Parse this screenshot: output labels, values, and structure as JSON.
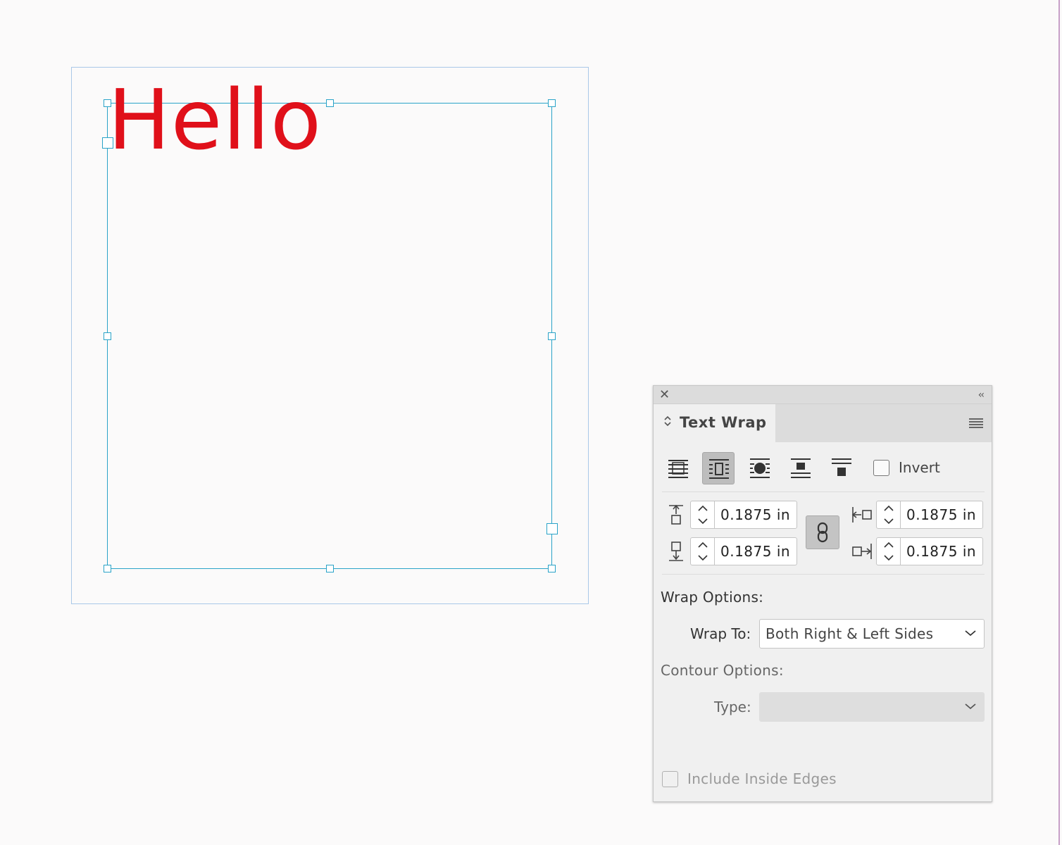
{
  "canvas": {
    "text": "Hello",
    "text_color": "#e0101a",
    "frame_color": "#2aa3c8"
  },
  "panel": {
    "title": "Text Wrap",
    "wrap_modes": [
      {
        "name": "no-text-wrap",
        "active": false
      },
      {
        "name": "wrap-around-bounding-box",
        "active": true
      },
      {
        "name": "wrap-around-object-shape",
        "active": false
      },
      {
        "name": "jump-object",
        "active": false
      },
      {
        "name": "jump-to-next-column",
        "active": false
      }
    ],
    "invert_label": "Invert",
    "offsets": {
      "top": "0.1875 in",
      "bottom": "0.1875 in",
      "left": "0.1875 in",
      "right": "0.1875 in"
    },
    "wrap_options_label": "Wrap Options:",
    "wrap_to_label": "Wrap To:",
    "wrap_to_value": "Both Right & Left Sides",
    "contour_options_label": "Contour Options:",
    "type_label": "Type:",
    "type_value": "",
    "include_inside_edges_label": "Include Inside Edges"
  }
}
